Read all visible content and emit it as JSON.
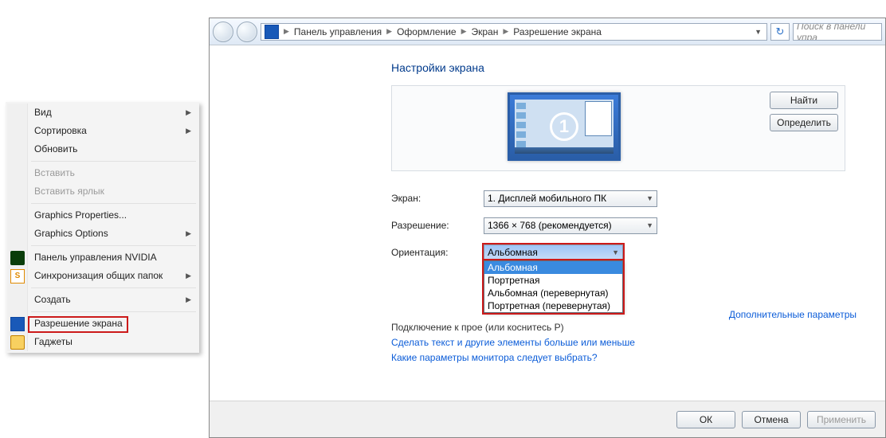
{
  "context_menu": {
    "items": [
      {
        "label": "Вид",
        "arrow": true,
        "disabled": false,
        "icon": null
      },
      {
        "label": "Сортировка",
        "arrow": true,
        "disabled": false,
        "icon": null
      },
      {
        "label": "Обновить",
        "arrow": false,
        "disabled": false,
        "icon": null
      },
      {
        "sep": true
      },
      {
        "label": "Вставить",
        "arrow": false,
        "disabled": true,
        "icon": null
      },
      {
        "label": "Вставить ярлык",
        "arrow": false,
        "disabled": true,
        "icon": null
      },
      {
        "sep": true
      },
      {
        "label": "Graphics Properties...",
        "arrow": false,
        "disabled": false,
        "icon": null
      },
      {
        "label": "Graphics Options",
        "arrow": true,
        "disabled": false,
        "icon": null
      },
      {
        "sep": true
      },
      {
        "label": "Панель управления NVIDIA",
        "arrow": false,
        "disabled": false,
        "icon": "nvidia"
      },
      {
        "label": "Синхронизация общих папок",
        "arrow": true,
        "disabled": false,
        "icon": "sync"
      },
      {
        "sep": true
      },
      {
        "label": "Создать",
        "arrow": true,
        "disabled": false,
        "icon": null
      },
      {
        "sep": true
      },
      {
        "label": "Разрешение экрана",
        "arrow": false,
        "disabled": false,
        "icon": "screen",
        "highlighted": true
      },
      {
        "label": "Гаджеты",
        "arrow": false,
        "disabled": false,
        "icon": "gadget"
      }
    ]
  },
  "navbar": {
    "crumbs": [
      "Панель управления",
      "Оформление",
      "Экран",
      "Разрешение экрана"
    ],
    "search_placeholder": "Поиск в панели упра"
  },
  "page": {
    "title": "Настройки экрана",
    "monitor_number": "1",
    "buttons": {
      "find": "Найти",
      "identify": "Определить"
    },
    "form": {
      "display_label": "Экран:",
      "display_value": "1. Дисплей мобильного ПК",
      "resolution_label": "Разрешение:",
      "resolution_value": "1366 × 768 (рекомендуется)",
      "orientation_label": "Ориентация:",
      "orientation_value": "Альбомная",
      "orientation_options": [
        "Альбомная",
        "Портретная",
        "Альбомная (перевернутая)",
        "Портретная (перевернутая)"
      ]
    },
    "advanced_link": "Дополнительные параметры",
    "para_projector_1": "Подключение к прое",
    "para_projector_2": " (или коснитесь P)",
    "para_text_link": "Сделать текст и другие элементы больше или меньше",
    "para_which_link": "Какие параметры монитора следует выбрать?"
  },
  "footer": {
    "ok": "ОК",
    "cancel": "Отмена",
    "apply": "Применить"
  }
}
